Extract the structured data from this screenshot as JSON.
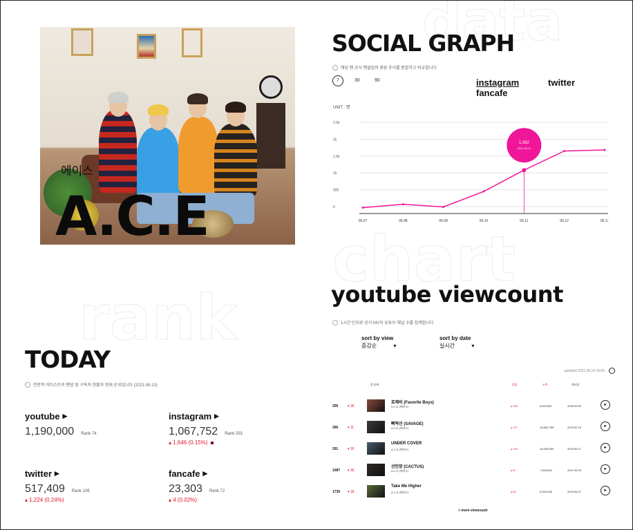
{
  "hero": {
    "kor_name": "에이스",
    "name": "A.C.E"
  },
  "social_graph": {
    "title": "SOCIAL GRAPH",
    "note": "해당 팬 공식 팬클럽의 총원 추이를 종합하고 비교합니다",
    "periods": [
      "7",
      "30",
      "90"
    ],
    "active_period": "7",
    "tabs": [
      "instagram",
      "twitter",
      "fancafe"
    ],
    "active_tab": "instagram"
  },
  "chart_data": {
    "type": "line",
    "title": "",
    "xlabel": "",
    "ylabel": "UNIT : 명",
    "categories": [
      "06.07",
      "06.08",
      "06.09",
      "06.10",
      "06.11",
      "06.12",
      "06.13"
    ],
    "y_ticks": [
      "0",
      "500",
      "1k",
      "1.5k",
      "2k",
      "2.5k"
    ],
    "ylim": [
      0,
      2500
    ],
    "series": [
      {
        "values": [
          -30,
          70,
          -10,
          450,
          1082,
          1650,
          1680
        ]
      }
    ],
    "highlight": {
      "index": 4,
      "value_label": "1,082",
      "date_label": "2021.06.11"
    },
    "color": "#f0169a",
    "grid": true
  },
  "today": {
    "title": "TODAY",
    "note": "전반적 아티스트의 팬덤 및 구독자 현황과 현재 순위입니다 (2021.06.13)",
    "stats": {
      "youtube": {
        "label": "youtube",
        "value": "1,190,000",
        "rank": "Rank 74",
        "change": ""
      },
      "instagram": {
        "label": "instagram",
        "value": "1,067,752",
        "rank": "Rank 253",
        "change": "▴ 1,646 (0.15%)"
      },
      "twitter": {
        "label": "twitter",
        "value": "517,409",
        "rank": "Rank 106",
        "change": "▴ 1,224 (0.24%)"
      },
      "fancafe": {
        "label": "fancafe",
        "value": "23,303",
        "rank": "Rank 72",
        "change": "▴ 4 (0.02%)"
      }
    }
  },
  "youtube": {
    "title": "youtube viewcount",
    "note": "1시간 단위로 공식 MV의 유튜브 채널 수를 집계합니다",
    "sort_view_label": "sort by view",
    "sort_view_value": "증감순",
    "sort_date_label": "sort by date",
    "sort_date_value": "실시간",
    "updated": "updated 2021.06.14 15:00",
    "headers": {
      "rank": "전 순위",
      "inc": "증감",
      "total": "누적",
      "date": "게시일"
    },
    "rows": [
      {
        "rank": "256",
        "delta": "▾ 36",
        "song": "호제비 (Favorite Boys)",
        "artist": "A.C.E (에이스)",
        "inc": "▴ 255",
        "total": "8,815,587",
        "date": "2020.09.03"
      },
      {
        "rank": "266",
        "delta": "▾ 11",
        "song": "삐딱선 (SAVAGE)",
        "artist": "A.C.E (에이스)",
        "inc": "▴ 237",
        "total": "16,582,789",
        "date": "2019.02.19"
      },
      {
        "rank": "291",
        "delta": "▾ 29",
        "song": "UNDER COVER",
        "artist": "A.C.E (에이스)",
        "inc": "▴ 195",
        "total": "16,093,563",
        "date": "2019.06.17"
      },
      {
        "rank": "1087",
        "delta": "▾ 36",
        "song": "선인장 (CACTUS)",
        "artist": "A.C.E (에이스)",
        "inc": "▴ 87",
        "total": "7,493,893",
        "date": "2017.05.23"
      },
      {
        "rank": "1736",
        "delta": "▾ 18",
        "song": "Take Me Higher",
        "artist": "A.C.E (에이스)",
        "inc": "▴ 65",
        "total": "6,033,335",
        "date": "2019.06.07"
      }
    ],
    "more": "+ more viewcount"
  },
  "background_words": [
    "rank",
    "chart",
    "data"
  ]
}
